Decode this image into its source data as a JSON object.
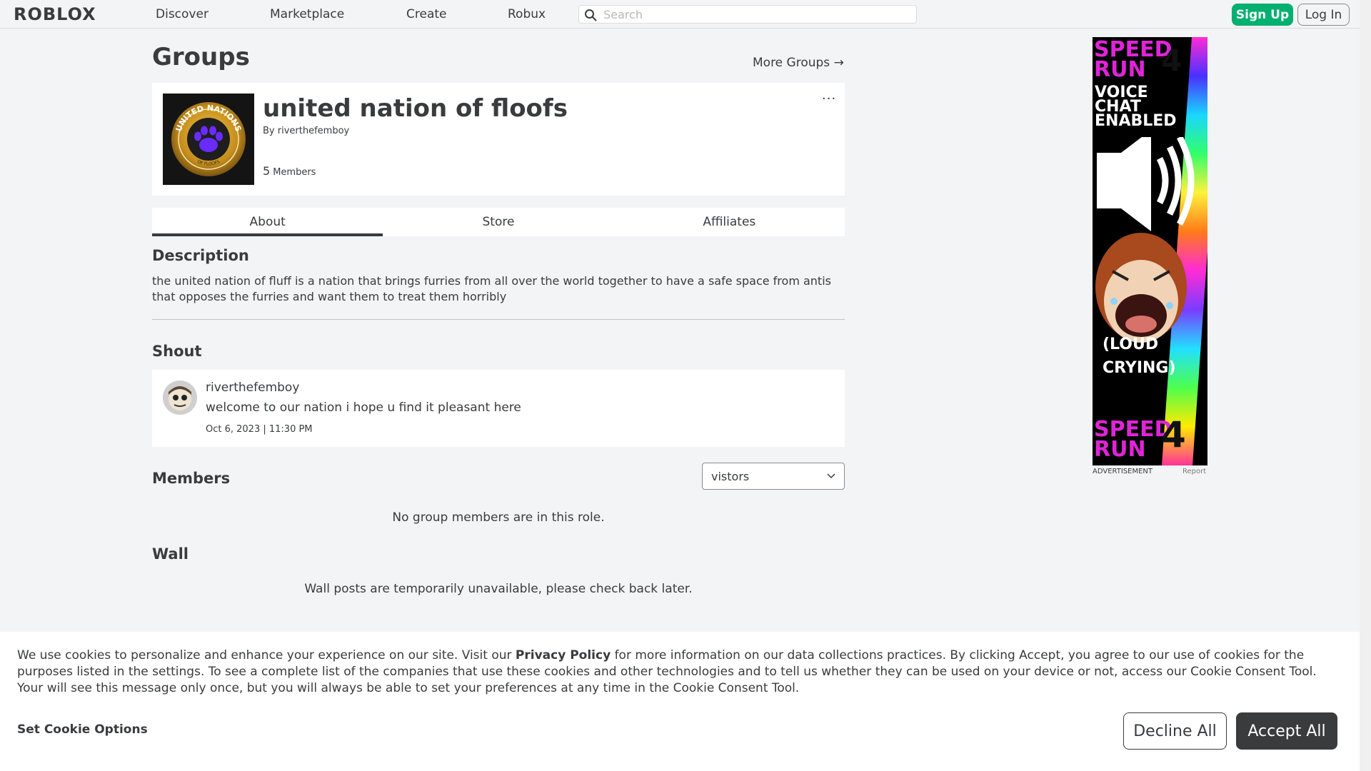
{
  "header": {
    "logo": "ROBLOX",
    "nav": [
      "Discover",
      "Marketplace",
      "Create",
      "Robux"
    ],
    "search_placeholder": "Search",
    "signup_label": "Sign Up",
    "login_label": "Log In"
  },
  "page": {
    "title": "Groups",
    "more_groups": "More Groups →"
  },
  "group": {
    "name": "united nation of floofs",
    "by_prefix": "By",
    "owner": "riverthefemboy",
    "member_count": "5",
    "members_label": "Members",
    "menu": "···",
    "emblem_text_top": "UNITED NATIONS",
    "emblem_text_bottom": "OF FLOOFS"
  },
  "tabs": [
    "About",
    "Store",
    "Affiliates"
  ],
  "description": {
    "heading": "Description",
    "text": "the united nation of fluff is a nation that brings furries from all over the world together to have a safe space from antis that opposes the furries and want them to treat them horribly"
  },
  "shout": {
    "heading": "Shout",
    "user": "riverthefemboy",
    "text": "welcome to our nation i hope u find it pleasant here",
    "time": "Oct 6, 2023 | 11:30 PM"
  },
  "members": {
    "heading": "Members",
    "role_selected": "vistors",
    "empty": "No group members are in this role."
  },
  "wall": {
    "heading": "Wall",
    "empty": "Wall posts are temporarily unavailable, please check back later."
  },
  "ad": {
    "title_top": "SPEED RUN",
    "number": "4",
    "subtitle": "VOICE CHAT ENABLED",
    "caption": "(LOUD CRYING)",
    "title_bottom": "SPEED RUN",
    "label": "ADVERTISEMENT",
    "report": "Report"
  },
  "cookie": {
    "text_before": "We use cookies to personalize and enhance your experience on our site. Visit our ",
    "policy_link": "Privacy Policy",
    "text_after": " for more information on our data collections practices. By clicking Accept, you agree to our use of cookies for the purposes listed in the settings. To see a complete list of the companies that use these cookies and other technologies and to tell us whether they can be used on your device or not, access our Cookie Consent Tool. Your will see this message only once, but you will always be able to set your preferences at any time in the Cookie Consent Tool.",
    "options": "Set Cookie Options",
    "decline": "Decline All",
    "accept": "Accept All"
  }
}
